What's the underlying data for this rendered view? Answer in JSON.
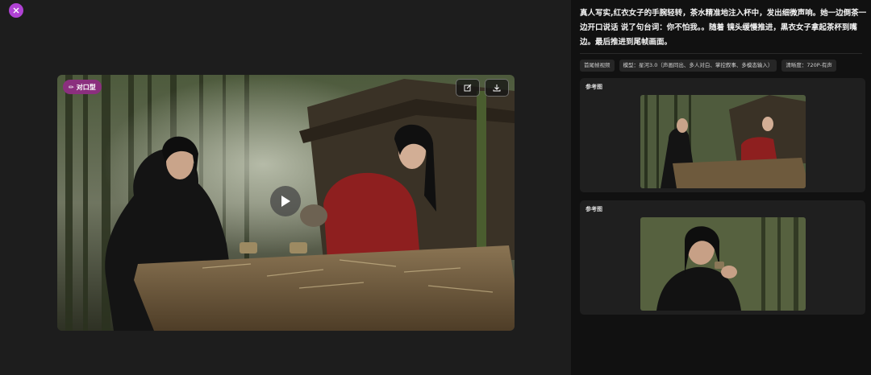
{
  "window": {
    "close_label": "×"
  },
  "video": {
    "badge_label": "对口型",
    "edit_icon": "edit-icon",
    "download_icon": "download-icon",
    "play_icon": "play-icon"
  },
  "details": {
    "prompt": "真人写实,红衣女子的手腕轻转，茶水精准地注入杯中，发出细微声响。她一边倒茶一边开口说话 说了句台词：你不怕我。。随着 镜头缓慢推进，黑衣女子拿起茶杯到嘴边。最后推进到尾帧画面。",
    "tags": [
      "首尾帧视频",
      "模型：星河3.0（声画同出、多人对白、掌控叙事、多模态输入）",
      "清晰度：720P-有声"
    ],
    "references": [
      {
        "label": "参考图"
      },
      {
        "label": "参考图"
      }
    ]
  },
  "colors": {
    "accent": "#b042d4",
    "badge": "#8b2f7e",
    "panel_bg": "#111111",
    "card_bg": "#1f1f1f"
  }
}
